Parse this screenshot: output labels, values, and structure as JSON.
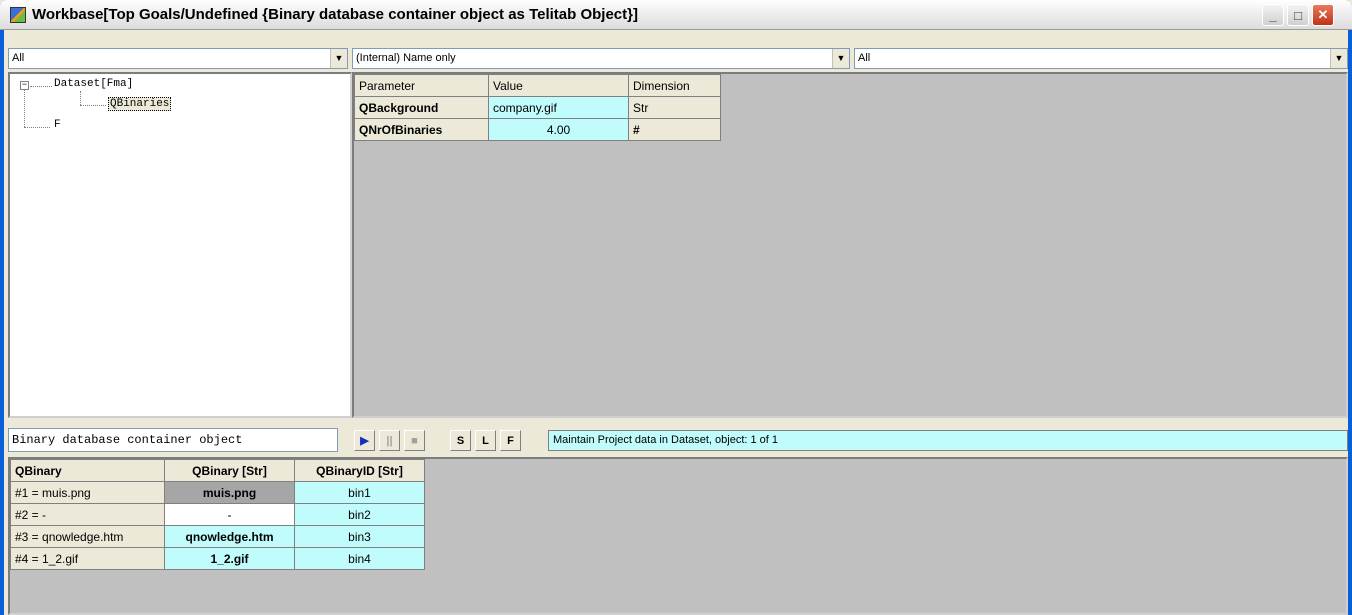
{
  "window": {
    "title": "Workbase[Top Goals/Undefined {Binary database container object as Telitab Object}]",
    "min_glyph": "_",
    "max_glyph": "□",
    "close_glyph": "✕"
  },
  "filters": {
    "left_combo": "All",
    "middle_combo": "(Internal) Name only",
    "right_combo": "All",
    "arrow_glyph": "▼"
  },
  "tree": {
    "nodes": [
      {
        "label": "Dataset[Fma]",
        "expander": "−"
      },
      {
        "label": "QBinaries"
      },
      {
        "label": "F"
      }
    ]
  },
  "params": {
    "headers": [
      "Parameter",
      "Value",
      "Dimension"
    ],
    "rows": [
      {
        "name": "QBackground",
        "value": "company.gif",
        "dimension": "Str"
      },
      {
        "name": "QNrOfBinaries",
        "value": "4.00",
        "dimension": "#"
      }
    ]
  },
  "object_label": "Binary database container object",
  "toolbar": {
    "play": "▶",
    "pause": "||",
    "stop": "■",
    "s": "S",
    "l": "L",
    "f": "F"
  },
  "message": "Maintain Project data in Dataset, object: 1 of 1",
  "binaries": {
    "headers": [
      "QBinary",
      "QBinary  [Str]",
      "QBinaryID  [Str]"
    ],
    "rows": [
      {
        "key": "#1 = muis.png",
        "name": "muis.png",
        "id": "bin1"
      },
      {
        "key": "#2 = -",
        "name": "-",
        "id": "bin2"
      },
      {
        "key": "#3 = qnowledge.htm",
        "name": "qnowledge.htm",
        "id": "bin3"
      },
      {
        "key": "#4 = 1_2.gif",
        "name": "1_2.gif",
        "id": "bin4"
      }
    ]
  },
  "colors": {
    "cyan_cell": "#c0fcfc",
    "grid_bg": "#c0c0c0",
    "selected_cell": "#a6a6a6"
  }
}
